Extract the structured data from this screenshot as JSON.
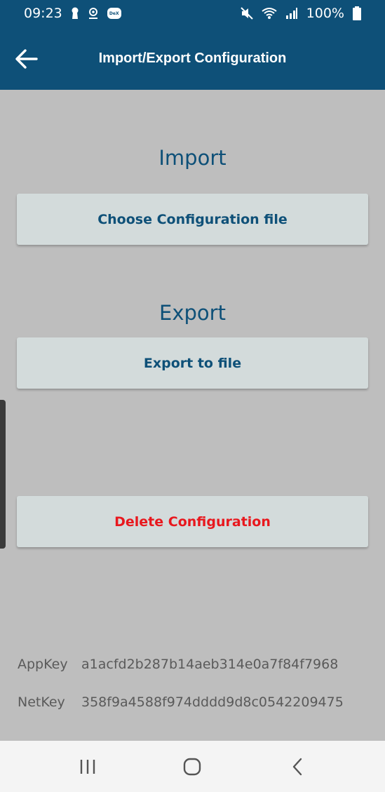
{
  "status_bar": {
    "time": "09:23",
    "battery": "100%",
    "icons": [
      "keyhole-icon",
      "location-icon",
      "dex-icon",
      "mute-icon",
      "wifi-icon",
      "signal-icon",
      "battery-icon"
    ],
    "dex_label": "DeX"
  },
  "app_bar": {
    "title": "Import/Export Configuration",
    "back_icon": "arrow-back-icon"
  },
  "import_section": {
    "heading": "Import",
    "button_label": "Choose Configuration file"
  },
  "export_section": {
    "heading": "Export",
    "button_label": "Export to file"
  },
  "delete_button_label": "Delete Configuration",
  "keys": [
    {
      "label": "AppKey",
      "value": "a1acfd2b287b14aeb314e0a7f84f7968"
    },
    {
      "label": "NetKey",
      "value": "358f9a4588f974dddd9d8c0542209475"
    }
  ],
  "colors": {
    "primary": "#0e5078",
    "background": "#bebebe",
    "button": "#d3dbdb",
    "danger": "#e8181e"
  },
  "nav_bar": {
    "icons": [
      "recent-apps-icon",
      "home-icon",
      "back-nav-icon"
    ]
  }
}
